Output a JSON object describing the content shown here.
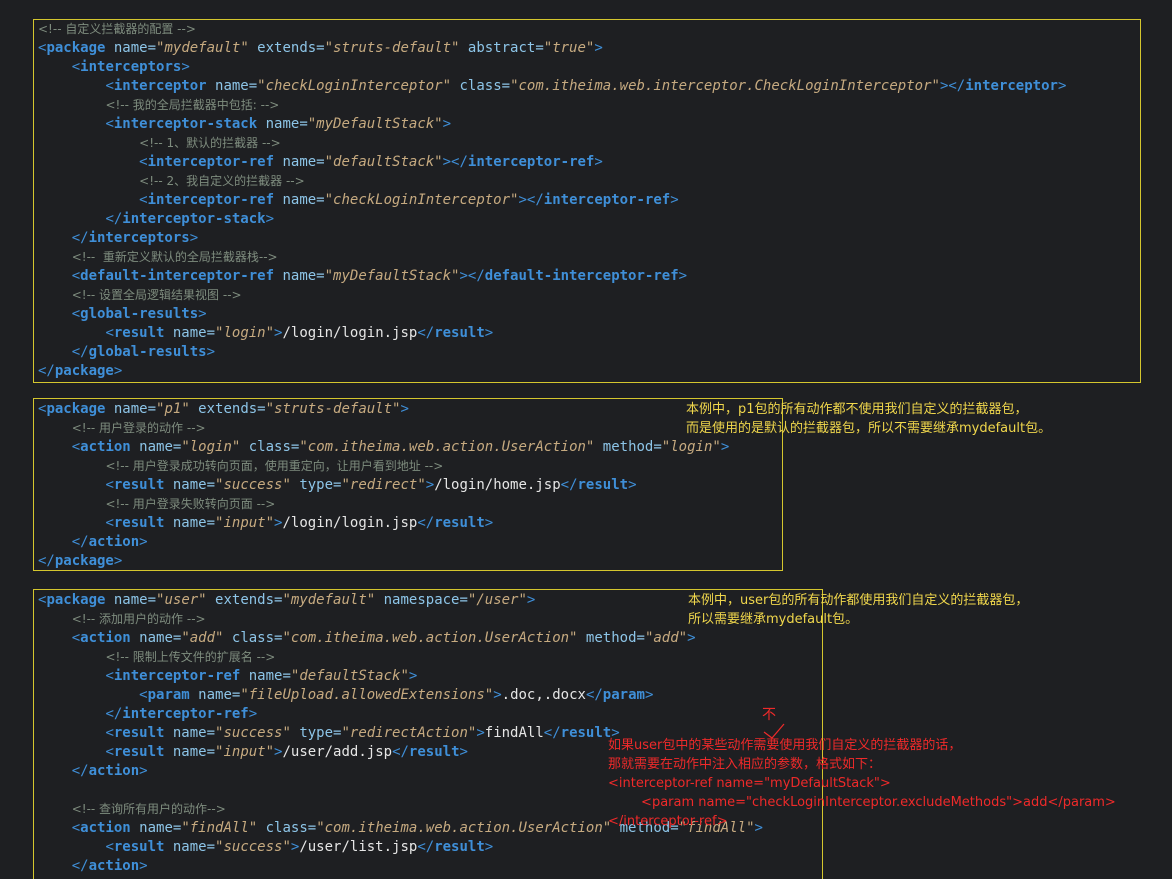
{
  "block1": {
    "lines": [
      [
        [
          "c",
          "<!-- 自定义拦截器的配置 -->"
        ]
      ],
      [
        [
          "p",
          "<"
        ],
        [
          "t",
          "package"
        ],
        [
          "a",
          " name="
        ],
        [
          "v",
          "\"mydefault\""
        ],
        [
          "a",
          " extends="
        ],
        [
          "v",
          "\"struts-default\""
        ],
        [
          "a",
          " abstract="
        ],
        [
          "v",
          "\"true\""
        ],
        [
          "p",
          ">"
        ]
      ],
      [
        [
          "i",
          "    "
        ],
        [
          "p",
          "<"
        ],
        [
          "t",
          "interceptors"
        ],
        [
          "p",
          ">"
        ]
      ],
      [
        [
          "i",
          "        "
        ],
        [
          "p",
          "<"
        ],
        [
          "t",
          "interceptor"
        ],
        [
          "a",
          " name="
        ],
        [
          "v",
          "\"checkLoginInterceptor\""
        ],
        [
          "a",
          " class="
        ],
        [
          "v",
          "\"com.itheima.web.interceptor.CheckLoginInterceptor\""
        ],
        [
          "p",
          "></"
        ],
        [
          "t",
          "interceptor"
        ],
        [
          "p",
          ">"
        ]
      ],
      [
        [
          "i",
          "        "
        ],
        [
          "c",
          "<!-- 我的全局拦截器中包括: -->"
        ]
      ],
      [
        [
          "i",
          "        "
        ],
        [
          "p",
          "<"
        ],
        [
          "t",
          "interceptor-stack"
        ],
        [
          "a",
          " name="
        ],
        [
          "v",
          "\"myDefaultStack\""
        ],
        [
          "p",
          ">"
        ]
      ],
      [
        [
          "i",
          "            "
        ],
        [
          "c",
          "<!-- 1、默认的拦截器 -->"
        ]
      ],
      [
        [
          "i",
          "            "
        ],
        [
          "p",
          "<"
        ],
        [
          "t",
          "interceptor-ref"
        ],
        [
          "a",
          " name="
        ],
        [
          "v",
          "\"defaultStack\""
        ],
        [
          "p",
          "></"
        ],
        [
          "t",
          "interceptor-ref"
        ],
        [
          "p",
          ">"
        ]
      ],
      [
        [
          "i",
          "            "
        ],
        [
          "c",
          "<!-- 2、我自定义的拦截器 -->"
        ]
      ],
      [
        [
          "i",
          "            "
        ],
        [
          "p",
          "<"
        ],
        [
          "t",
          "interceptor-ref"
        ],
        [
          "a",
          " name="
        ],
        [
          "v",
          "\"checkLoginInterceptor\""
        ],
        [
          "p",
          "></"
        ],
        [
          "t",
          "interceptor-ref"
        ],
        [
          "p",
          ">"
        ]
      ],
      [
        [
          "i",
          "        "
        ],
        [
          "p",
          "</"
        ],
        [
          "t",
          "interceptor-stack"
        ],
        [
          "p",
          ">"
        ]
      ],
      [
        [
          "i",
          "    "
        ],
        [
          "p",
          "</"
        ],
        [
          "t",
          "interceptors"
        ],
        [
          "p",
          ">"
        ]
      ],
      [
        [
          "i",
          "    "
        ],
        [
          "c",
          "<!--  重新定义默认的全局拦截器栈-->"
        ]
      ],
      [
        [
          "i",
          "    "
        ],
        [
          "p",
          "<"
        ],
        [
          "t",
          "default-interceptor-ref"
        ],
        [
          "a",
          " name="
        ],
        [
          "v",
          "\"myDefaultStack\""
        ],
        [
          "p",
          "></"
        ],
        [
          "t",
          "default-interceptor-ref"
        ],
        [
          "p",
          ">"
        ]
      ],
      [
        [
          "i",
          "    "
        ],
        [
          "c",
          "<!-- 设置全局逻辑结果视图 -->"
        ]
      ],
      [
        [
          "i",
          "    "
        ],
        [
          "p",
          "<"
        ],
        [
          "t",
          "global-results"
        ],
        [
          "p",
          ">"
        ]
      ],
      [
        [
          "i",
          "        "
        ],
        [
          "p",
          "<"
        ],
        [
          "t",
          "result"
        ],
        [
          "a",
          " name="
        ],
        [
          "v",
          "\"login\""
        ],
        [
          "p",
          ">"
        ],
        [
          "tx",
          "/login/login.jsp"
        ],
        [
          "p",
          "</"
        ],
        [
          "t",
          "result"
        ],
        [
          "p",
          ">"
        ]
      ],
      [
        [
          "i",
          "    "
        ],
        [
          "p",
          "</"
        ],
        [
          "t",
          "global-results"
        ],
        [
          "p",
          ">"
        ]
      ],
      [
        [
          "p",
          "</"
        ],
        [
          "t",
          "package"
        ],
        [
          "p",
          ">"
        ]
      ]
    ]
  },
  "block2": {
    "lines": [
      [
        [
          "p",
          "<"
        ],
        [
          "t",
          "package"
        ],
        [
          "a",
          " name="
        ],
        [
          "v",
          "\"p1\""
        ],
        [
          "a",
          " extends="
        ],
        [
          "v",
          "\"struts-default\""
        ],
        [
          "p",
          ">"
        ]
      ],
      [
        [
          "i",
          "    "
        ],
        [
          "c",
          "<!-- 用户登录的动作 -->"
        ]
      ],
      [
        [
          "i",
          "    "
        ],
        [
          "p",
          "<"
        ],
        [
          "t",
          "action"
        ],
        [
          "a",
          " name="
        ],
        [
          "v",
          "\"login\""
        ],
        [
          "a",
          " class="
        ],
        [
          "v",
          "\"com.itheima.web.action.UserAction\""
        ],
        [
          "a",
          " method="
        ],
        [
          "v",
          "\"login\""
        ],
        [
          "p",
          ">"
        ]
      ],
      [
        [
          "i",
          "        "
        ],
        [
          "c",
          "<!-- 用户登录成功转向页面，使用重定向，让用户看到地址 -->"
        ]
      ],
      [
        [
          "i",
          "        "
        ],
        [
          "p",
          "<"
        ],
        [
          "t",
          "result"
        ],
        [
          "a",
          " name="
        ],
        [
          "v",
          "\"success\""
        ],
        [
          "a",
          " type="
        ],
        [
          "v",
          "\"redirect\""
        ],
        [
          "p",
          ">"
        ],
        [
          "tx",
          "/login/home.jsp"
        ],
        [
          "p",
          "</"
        ],
        [
          "t",
          "result"
        ],
        [
          "p",
          ">"
        ]
      ],
      [
        [
          "i",
          "        "
        ],
        [
          "c",
          "<!-- 用户登录失败转向页面 -->"
        ]
      ],
      [
        [
          "i",
          "        "
        ],
        [
          "p",
          "<"
        ],
        [
          "t",
          "result"
        ],
        [
          "a",
          " name="
        ],
        [
          "v",
          "\"input\""
        ],
        [
          "p",
          ">"
        ],
        [
          "tx",
          "/login/login.jsp"
        ],
        [
          "p",
          "</"
        ],
        [
          "t",
          "result"
        ],
        [
          "p",
          ">"
        ]
      ],
      [
        [
          "i",
          "    "
        ],
        [
          "p",
          "</"
        ],
        [
          "t",
          "action"
        ],
        [
          "p",
          ">"
        ]
      ],
      [
        [
          "p",
          "</"
        ],
        [
          "t",
          "package"
        ],
        [
          "p",
          ">"
        ]
      ]
    ]
  },
  "block3": {
    "lines": [
      [
        [
          "p",
          "<"
        ],
        [
          "t",
          "package"
        ],
        [
          "a",
          " name="
        ],
        [
          "v",
          "\"user\""
        ],
        [
          "a",
          " extends="
        ],
        [
          "v",
          "\"mydefault\""
        ],
        [
          "a",
          " namespace="
        ],
        [
          "v",
          "\"/user\""
        ],
        [
          "p",
          ">"
        ]
      ],
      [
        [
          "i",
          "    "
        ],
        [
          "c",
          "<!-- 添加用户的动作 -->"
        ]
      ],
      [
        [
          "i",
          "    "
        ],
        [
          "p",
          "<"
        ],
        [
          "t",
          "action"
        ],
        [
          "a",
          " name="
        ],
        [
          "v",
          "\"add\""
        ],
        [
          "a",
          " class="
        ],
        [
          "v",
          "\"com.itheima.web.action.UserAction\""
        ],
        [
          "a",
          " method="
        ],
        [
          "v",
          "\"add\""
        ],
        [
          "p",
          ">"
        ]
      ],
      [
        [
          "i",
          "        "
        ],
        [
          "c",
          "<!-- 限制上传文件的扩展名 -->"
        ]
      ],
      [
        [
          "i",
          "        "
        ],
        [
          "p",
          "<"
        ],
        [
          "t",
          "interceptor-ref"
        ],
        [
          "a",
          " name="
        ],
        [
          "v",
          "\"defaultStack\""
        ],
        [
          "p",
          ">"
        ]
      ],
      [
        [
          "i",
          "            "
        ],
        [
          "p",
          "<"
        ],
        [
          "t",
          "param"
        ],
        [
          "a",
          " name="
        ],
        [
          "v",
          "\"fileUpload.allowedExtensions\""
        ],
        [
          "p",
          ">"
        ],
        [
          "tx",
          ".doc,.docx"
        ],
        [
          "p",
          "</"
        ],
        [
          "t",
          "param"
        ],
        [
          "p",
          ">"
        ]
      ],
      [
        [
          "i",
          "        "
        ],
        [
          "p",
          "</"
        ],
        [
          "t",
          "interceptor-ref"
        ],
        [
          "p",
          ">"
        ]
      ],
      [
        [
          "i",
          "        "
        ],
        [
          "p",
          "<"
        ],
        [
          "t",
          "result"
        ],
        [
          "a",
          " name="
        ],
        [
          "v",
          "\"success\""
        ],
        [
          "a",
          " type="
        ],
        [
          "v",
          "\"redirectAction\""
        ],
        [
          "p",
          ">"
        ],
        [
          "tx",
          "findAll"
        ],
        [
          "p",
          "</"
        ],
        [
          "t",
          "result"
        ],
        [
          "p",
          ">"
        ]
      ],
      [
        [
          "i",
          "        "
        ],
        [
          "p",
          "<"
        ],
        [
          "t",
          "result"
        ],
        [
          "a",
          " name="
        ],
        [
          "v",
          "\"input\""
        ],
        [
          "p",
          ">"
        ],
        [
          "tx",
          "/user/add.jsp"
        ],
        [
          "p",
          "</"
        ],
        [
          "t",
          "result"
        ],
        [
          "p",
          ">"
        ]
      ],
      [
        [
          "i",
          "    "
        ],
        [
          "p",
          "</"
        ],
        [
          "t",
          "action"
        ],
        [
          "p",
          ">"
        ]
      ],
      [],
      [
        [
          "i",
          "    "
        ],
        [
          "c",
          "<!-- 查询所有用户的动作-->"
        ]
      ],
      [
        [
          "i",
          "    "
        ],
        [
          "p",
          "<"
        ],
        [
          "t",
          "action"
        ],
        [
          "a",
          " name="
        ],
        [
          "v",
          "\"findAll\""
        ],
        [
          "a",
          " class="
        ],
        [
          "v",
          "\"com.itheima.web.action.UserAction\""
        ],
        [
          "a",
          " method="
        ],
        [
          "v",
          "\"findAll\""
        ],
        [
          "p",
          ">"
        ]
      ],
      [
        [
          "i",
          "        "
        ],
        [
          "p",
          "<"
        ],
        [
          "t",
          "result"
        ],
        [
          "a",
          " name="
        ],
        [
          "v",
          "\"success\""
        ],
        [
          "p",
          ">"
        ],
        [
          "tx",
          "/user/list.jsp"
        ],
        [
          "p",
          "</"
        ],
        [
          "t",
          "result"
        ],
        [
          "p",
          ">"
        ]
      ],
      [
        [
          "i",
          "    "
        ],
        [
          "p",
          "</"
        ],
        [
          "t",
          "action"
        ],
        [
          "p",
          ">"
        ]
      ]
    ]
  },
  "notes": {
    "p1_line1": "本例中，p1包的所有动作都不使用我们自定义的拦截器包，",
    "p1_line2": "而是使用的是默认的拦截器包，所以不需要继承mydefault包。",
    "user_line1": "本例中，user包的所有动作都使用我们自定义的拦截器包，",
    "user_line2": "所以需要继承mydefault包。",
    "red_mark": "不",
    "red_line1": "如果user包中的某些动作需要使用我们自定义的拦截器的话，",
    "red_line2": "那就需要在动作中注入相应的参数，格式如下：",
    "red_line3": "<interceptor-ref name=\"myDefaultStack\">",
    "red_line4": "        <param name=\"checkLoginInterceptor.excludeMethods\">add</param>",
    "red_line5": "</interceptor-ref>"
  },
  "colors": {
    "background": "#1e1f22",
    "box_border": "#d4c62e",
    "tag": "#3f8fd8",
    "attr": "#8dc5e8",
    "value": "#c6aa80",
    "comment": "#7e8c7e",
    "note_yellow": "#f0d74c",
    "note_red": "#ee2a2a"
  }
}
